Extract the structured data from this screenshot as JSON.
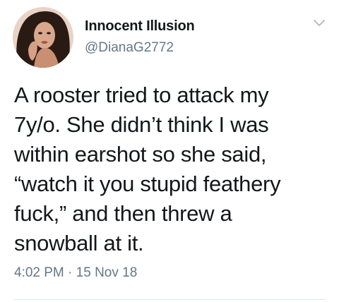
{
  "tweet": {
    "display_name": "Innocent Illusion",
    "handle": "@DianaG2772",
    "text": "A rooster tried to attack my\n7y/o. She didn’t think I was\nwithin earshot so she said,\n“watch it you stupid feathery\nfuck,” and then threw a\nsnowball at it.",
    "time": "4:02 PM",
    "separator": " · ",
    "date": "15 Nov 18"
  },
  "icons": {
    "avatar": "profile-photo",
    "menu": "chevron-down-icon"
  },
  "colors": {
    "text": "#14171a",
    "secondary": "#657786",
    "divider": "#e1e8ed"
  }
}
